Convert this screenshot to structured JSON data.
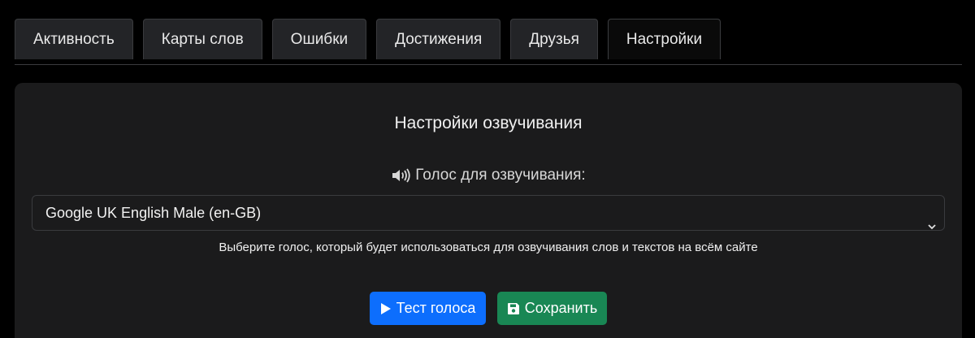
{
  "tabs": [
    {
      "label": "Активность"
    },
    {
      "label": "Карты слов"
    },
    {
      "label": "Ошибки"
    },
    {
      "label": "Достижения"
    },
    {
      "label": "Друзья"
    },
    {
      "label": "Настройки",
      "active": true
    }
  ],
  "settings": {
    "title": "Настройки озвучивания",
    "voice_label": "Голос для озвучивания:",
    "voice_icon": "speaker-icon",
    "voice_select": {
      "selected": "Google UK English Male (en-GB)"
    },
    "help_text": "Выберите голос, который будет использоваться для озвучивания слов и текстов на всём сайте",
    "test_button": {
      "label": "Тест голоса",
      "icon": "play-icon",
      "color": "#0d6efd"
    },
    "save_button": {
      "label": "Сохранить",
      "icon": "floppy-disk-icon",
      "color": "#198754"
    }
  },
  "colors": {
    "background": "#000000",
    "card": "#1b1b1c",
    "tab": "#232427"
  }
}
